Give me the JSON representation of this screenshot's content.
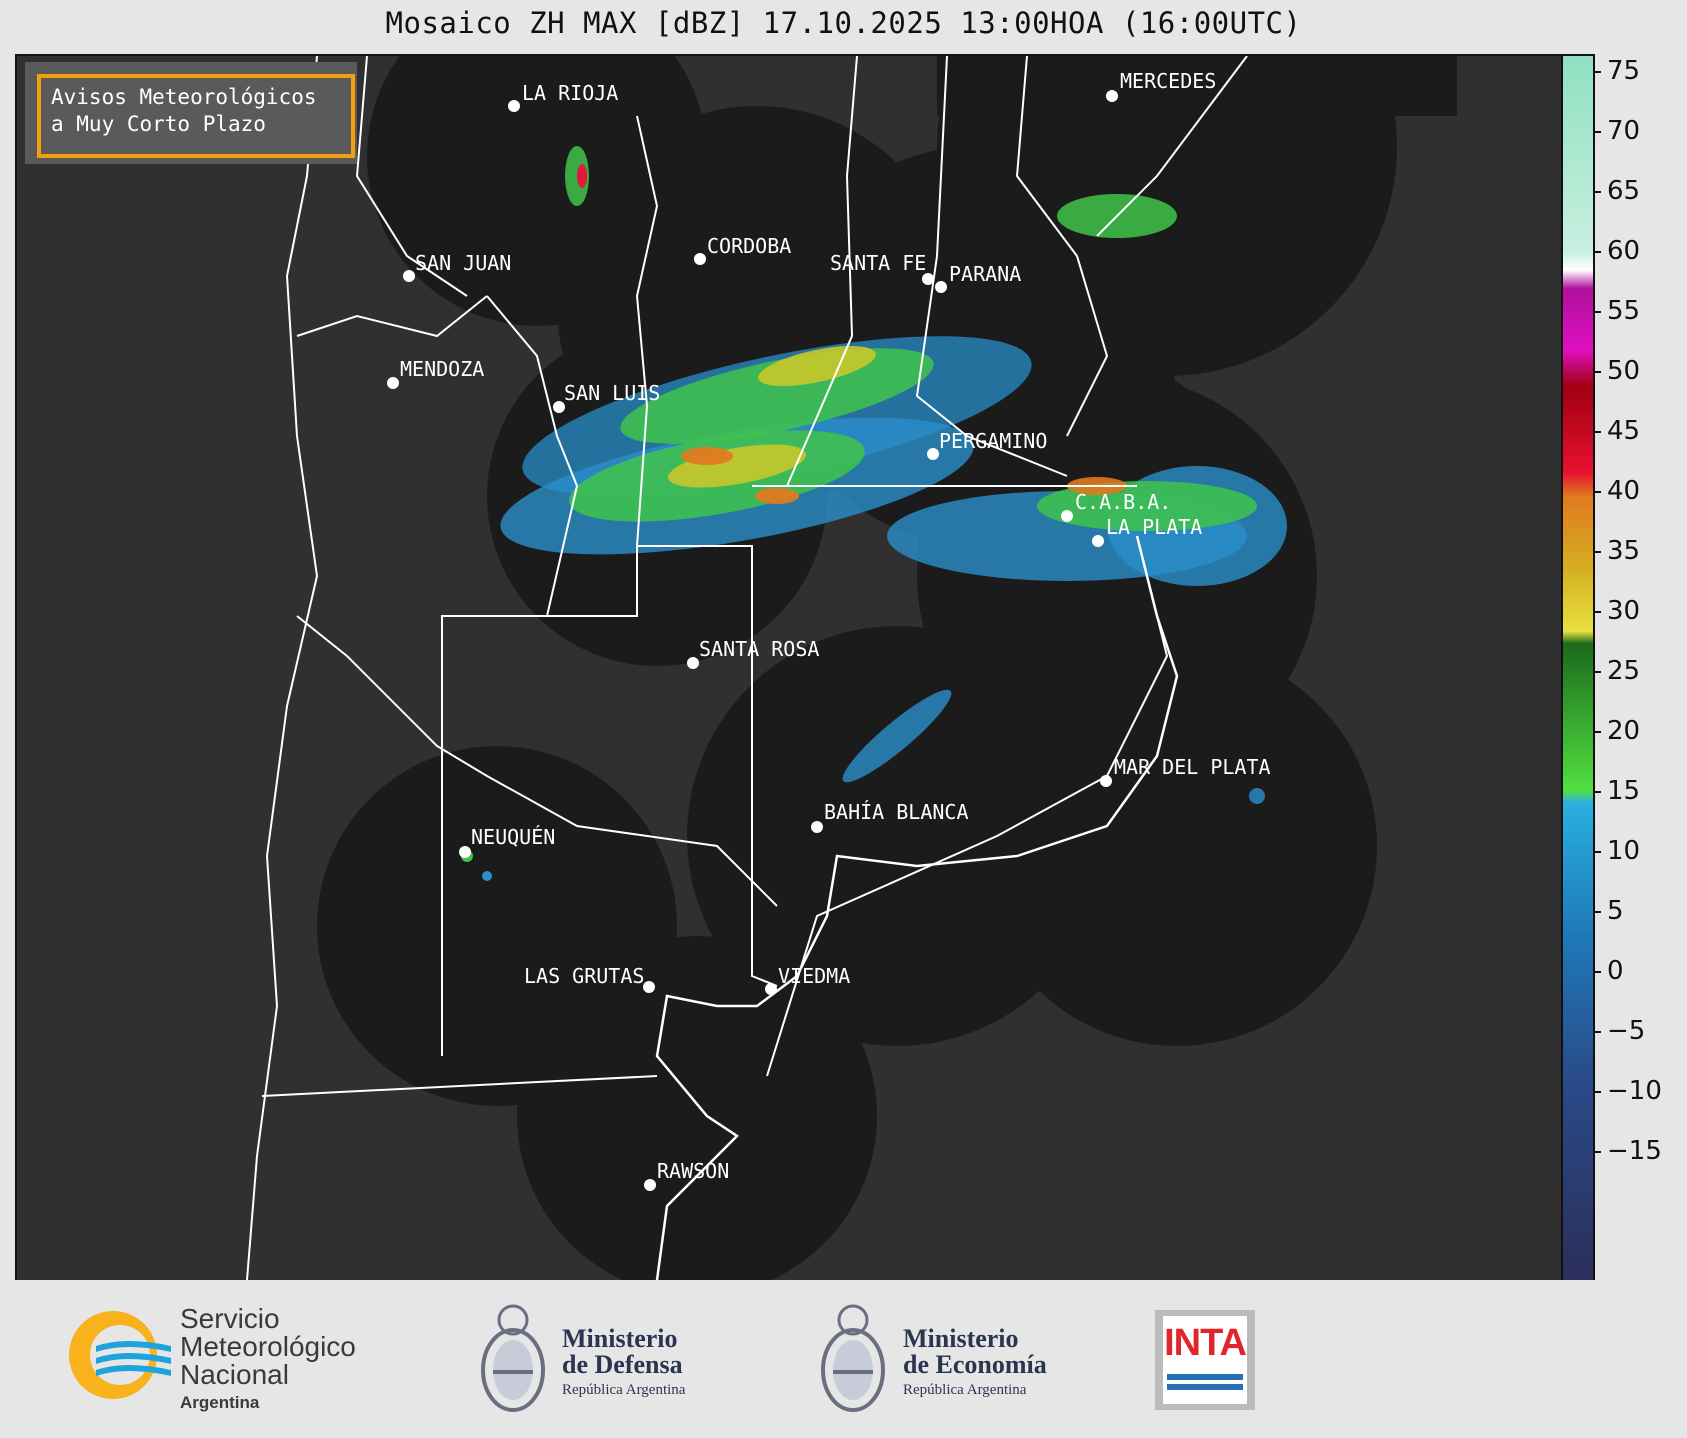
{
  "title": "Mosaico ZH MAX [dBZ] 17.10.2025 13:00HOA (16:00UTC)",
  "avisos": {
    "line1": "Avisos Meteorológicos",
    "line2": "a Muy Corto Plazo"
  },
  "cities": [
    {
      "id": "la-rioja",
      "name": "LA RIOJA"
    },
    {
      "id": "mercedes",
      "name": "MERCEDES"
    },
    {
      "id": "cordoba",
      "name": "CORDOBA"
    },
    {
      "id": "san-juan",
      "name": "SAN JUAN"
    },
    {
      "id": "santa-fe",
      "name": "SANTA FE"
    },
    {
      "id": "parana",
      "name": "PARANA"
    },
    {
      "id": "mendoza",
      "name": "MENDOZA"
    },
    {
      "id": "san-luis",
      "name": "SAN LUIS"
    },
    {
      "id": "pergamino",
      "name": "PERGAMINO"
    },
    {
      "id": "caba",
      "name": "C.A.B.A."
    },
    {
      "id": "la-plata",
      "name": "LA PLATA"
    },
    {
      "id": "santa-rosa",
      "name": "SANTA ROSA"
    },
    {
      "id": "mar-del-plata",
      "name": "MAR DEL PLATA"
    },
    {
      "id": "bahia-blanca",
      "name": "BAHÍA BLANCA"
    },
    {
      "id": "neuquen",
      "name": "NEUQUÉN"
    },
    {
      "id": "las-grutas",
      "name": "LAS GRUTAS"
    },
    {
      "id": "viedma",
      "name": "VIEDMA"
    },
    {
      "id": "rawson",
      "name": "RAWSON"
    }
  ],
  "colorbar": {
    "unit": "dBZ",
    "ticks": [
      "75",
      "70",
      "65",
      "60",
      "55",
      "50",
      "45",
      "40",
      "35",
      "30",
      "25",
      "20",
      "15",
      "10",
      "5",
      "0",
      "−5",
      "−10",
      "−15"
    ],
    "range": [
      -18.5,
      76.5
    ]
  },
  "footer": {
    "smn_line1": "Servicio",
    "smn_line2": "Meteorológico",
    "smn_line3": "Nacional",
    "smn_line4": "Argentina",
    "defensa_line1": "Ministerio",
    "defensa_line2": "de Defensa",
    "defensa_sub": "República Argentina",
    "economia_line1": "Ministerio",
    "economia_line2": "de Economía",
    "economia_sub": "República Argentina",
    "inta": "INTA"
  },
  "colors": {
    "map_background": "#303030",
    "radar_coverage": "#1b1b1b",
    "border": "#ffffff",
    "avisos_border": "#f0a010",
    "inta_red": "#e0262b",
    "inta_blue": "#2a6fb5",
    "smn_orange": "#f7b21c",
    "smn_blue": "#1fa3dc"
  }
}
